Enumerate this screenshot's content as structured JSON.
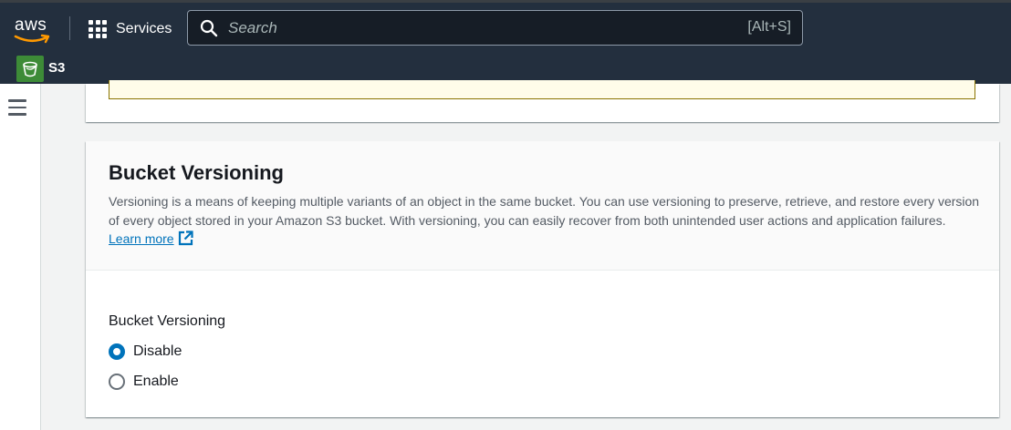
{
  "header": {
    "logo_text": "aws",
    "services_label": "Services",
    "search": {
      "placeholder": "Search",
      "shortcut": "[Alt+S]"
    },
    "service_name": "S3"
  },
  "sidebar": {
    "menu_icon": "hamburger-icon"
  },
  "versioning_panel": {
    "title": "Bucket Versioning",
    "description": "Versioning is a means of keeping multiple variants of an object in the same bucket. You can use versioning to preserve, retrieve, and restore every version of every object stored in your Amazon S3 bucket. With versioning, you can easily recover from both unintended user actions and application failures.",
    "learn_more": "Learn more",
    "field_label": "Bucket Versioning",
    "options": [
      {
        "label": "Disable",
        "selected": true
      },
      {
        "label": "Enable",
        "selected": false
      }
    ]
  },
  "colors": {
    "header_bg": "#232f3e",
    "link": "#0073bb",
    "radio_selected": "#0073bb",
    "s3_badge": "#3d8b37",
    "warning_bg": "#fffce9"
  }
}
